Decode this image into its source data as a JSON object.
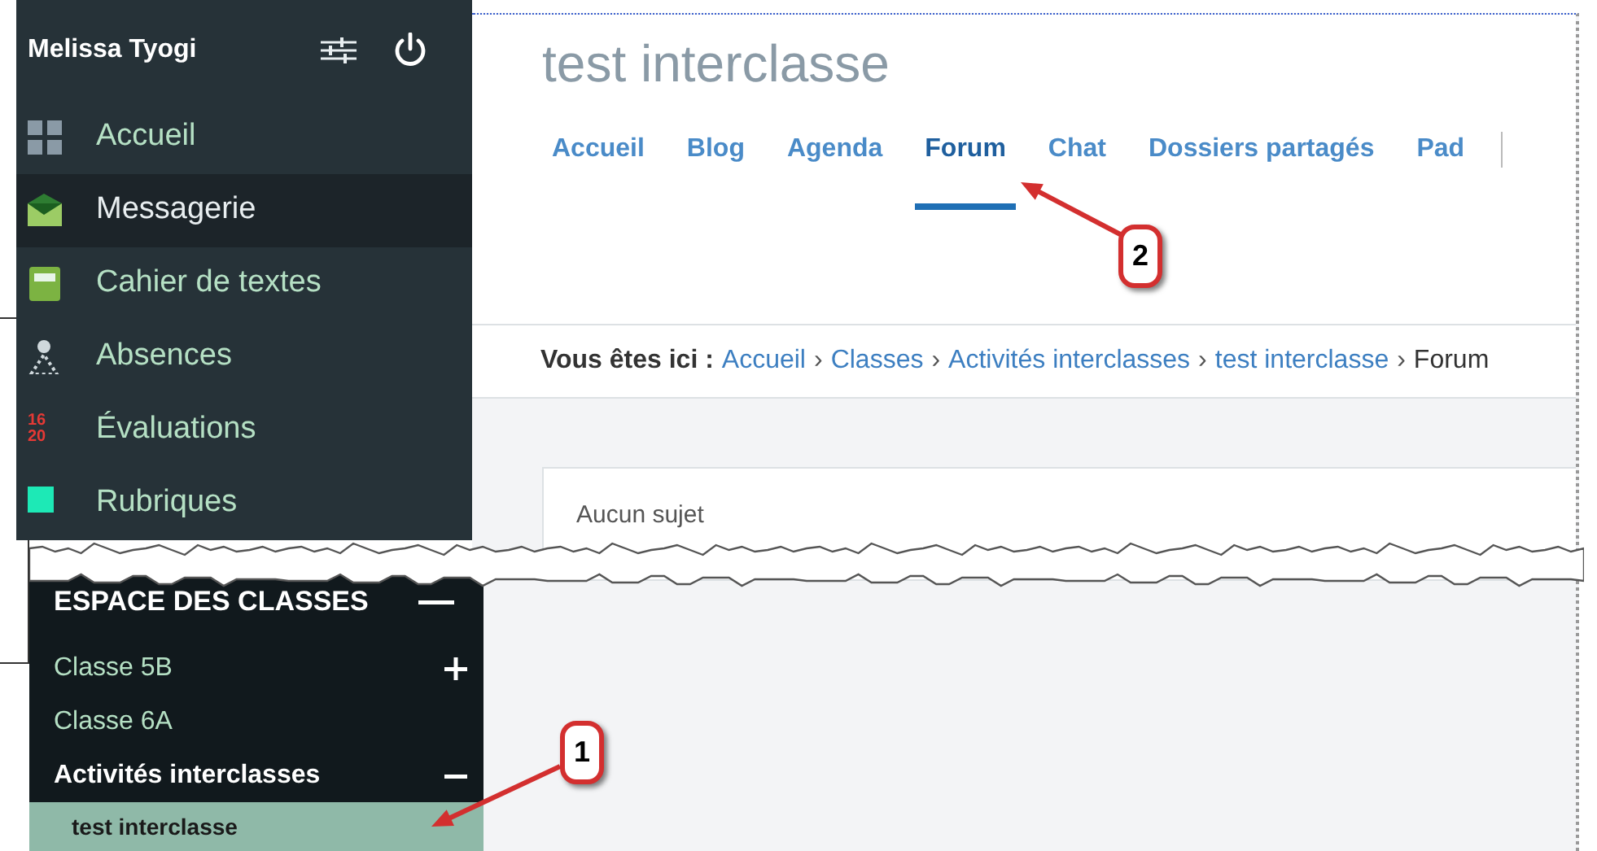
{
  "sidebar": {
    "user_name": "Melissa Tyogi",
    "menu": [
      {
        "label": "Accueil",
        "selected": false
      },
      {
        "label": "Messagerie",
        "selected": true
      },
      {
        "label": "Cahier de textes",
        "selected": false
      },
      {
        "label": "Absences",
        "selected": false
      },
      {
        "label": "Évaluations",
        "selected": false,
        "icon_text": [
          "16",
          "20"
        ]
      },
      {
        "label": "Rubriques",
        "selected": false
      }
    ],
    "classes_section": {
      "title": "ESPACE DES CLASSES",
      "expanded": true,
      "items": [
        {
          "label": "Classe 5B",
          "kind": "group",
          "expanded": false,
          "selected": false
        },
        {
          "label": "Classe 6A",
          "kind": "class",
          "selected": false
        },
        {
          "label": "Activités interclasses",
          "kind": "group",
          "expanded": true,
          "selected": false,
          "children": [
            {
              "label": "test interclasse",
              "selected": true
            }
          ]
        }
      ]
    }
  },
  "main": {
    "page_title": "test interclasse",
    "tabs": [
      {
        "label": "Accueil",
        "selected": false
      },
      {
        "label": "Blog",
        "selected": false
      },
      {
        "label": "Agenda",
        "selected": false
      },
      {
        "label": "Forum",
        "selected": true
      },
      {
        "label": "Chat",
        "selected": false
      },
      {
        "label": "Dossiers partagés",
        "selected": false
      },
      {
        "label": "Pad",
        "selected": false
      }
    ],
    "breadcrumb": [
      {
        "text": "Vous êtes ici :",
        "kind": "prefix"
      },
      {
        "text": "Accueil",
        "kind": "link"
      },
      {
        "text": "›",
        "kind": "separator"
      },
      {
        "text": "Classes",
        "kind": "link"
      },
      {
        "text": "›",
        "kind": "separator"
      },
      {
        "text": "Activités interclasses",
        "kind": "link"
      },
      {
        "text": "›",
        "kind": "separator"
      },
      {
        "text": "test interclasse",
        "kind": "link"
      },
      {
        "text": "›",
        "kind": "separator"
      },
      {
        "text": "Forum",
        "kind": "current"
      }
    ],
    "empty_message": "Aucun sujet"
  },
  "annotations": [
    {
      "label": "1"
    },
    {
      "label": "2"
    }
  ]
}
